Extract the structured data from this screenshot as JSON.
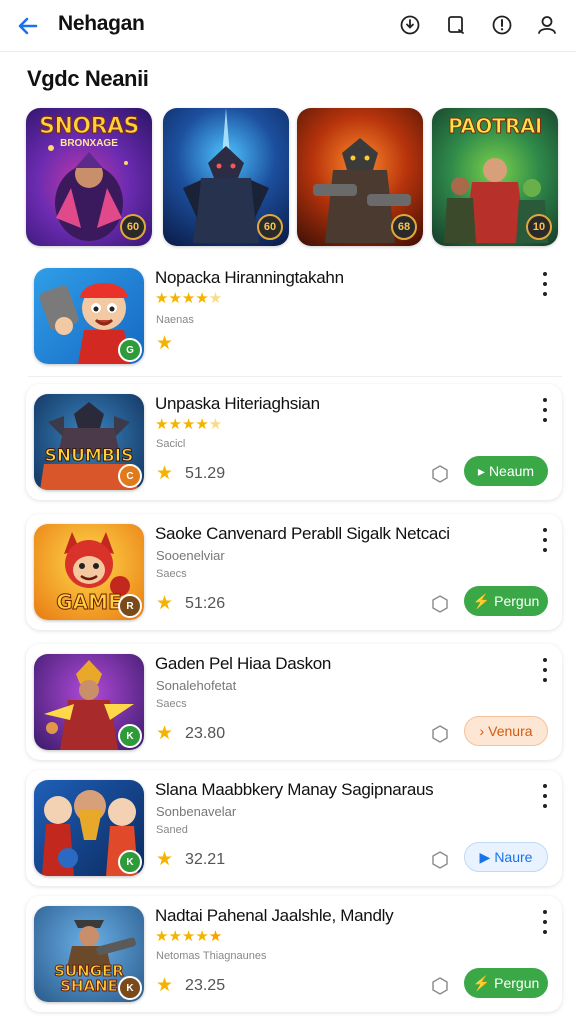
{
  "header": {
    "title": "Nehagan",
    "icons": [
      "arrow-back-icon",
      "download-icon",
      "bookmark-icon",
      "info-icon",
      "profile-icon"
    ]
  },
  "section": {
    "title": "Vgdc Neanii"
  },
  "featured": [
    {
      "title": "SNORAS",
      "subtitle": "BRONXAGE",
      "badge": "60"
    },
    {
      "title": "",
      "subtitle": "",
      "badge": "60"
    },
    {
      "title": "",
      "subtitle": "",
      "badge": "68"
    },
    {
      "title": "PAOTRAI",
      "subtitle": "",
      "badge": "10"
    }
  ],
  "games": [
    {
      "name": "Nopacka Hiranningtakahn",
      "category": "Naenas",
      "rating": "",
      "rating_stars": 3.5,
      "action": "",
      "action_style": "",
      "thumb_text": "",
      "badge": "G"
    },
    {
      "name": "Unpaska Hiteriaghsian",
      "category": "Sacicl",
      "rating": "51.29",
      "rating_stars": 4,
      "action": "Neaum",
      "action_style": "green",
      "action_icon": "▸",
      "thumb_text": "SNUMBIS",
      "badge": "C"
    },
    {
      "name": "Saoke Canvenard Perabll Sigalk Netcaci",
      "subtitle": "Sooenelviar",
      "category": "Saecs",
      "rating": "51:26",
      "action": "Pergun",
      "action_style": "green",
      "action_icon": "⚡",
      "thumb_text": "GAME",
      "badge": "R"
    },
    {
      "name": "Gaden Pel Hiaa Daskon",
      "subtitle": "Sonalehofetat",
      "category": "Saecs",
      "rating": "23.80",
      "action": "Venura",
      "action_style": "orange",
      "action_icon": "›",
      "thumb_text": "",
      "badge": "K"
    },
    {
      "name": "Slana Maabbkery Manay Sagipnaraus",
      "subtitle": "Sonbenavelar",
      "category": "Saned",
      "rating": "32.21",
      "action": "Naure",
      "action_style": "blue",
      "action_icon": "▶",
      "thumb_text": "",
      "badge": "K"
    },
    {
      "name": "Nadtai Pahenal Jaalshle, Mandly",
      "subtitle": "Netomas Thiagnaunes",
      "rating_stars": 4.5,
      "rating": "23.25",
      "action": "Pergun",
      "action_style": "green",
      "action_icon": "⚡",
      "thumb_text": "SUNGER SHANE",
      "badge": "K"
    }
  ],
  "colors": {
    "accent": "#1a73e8",
    "green": "#3aa846",
    "star": "#f5b301",
    "orange": "#d05b10"
  }
}
